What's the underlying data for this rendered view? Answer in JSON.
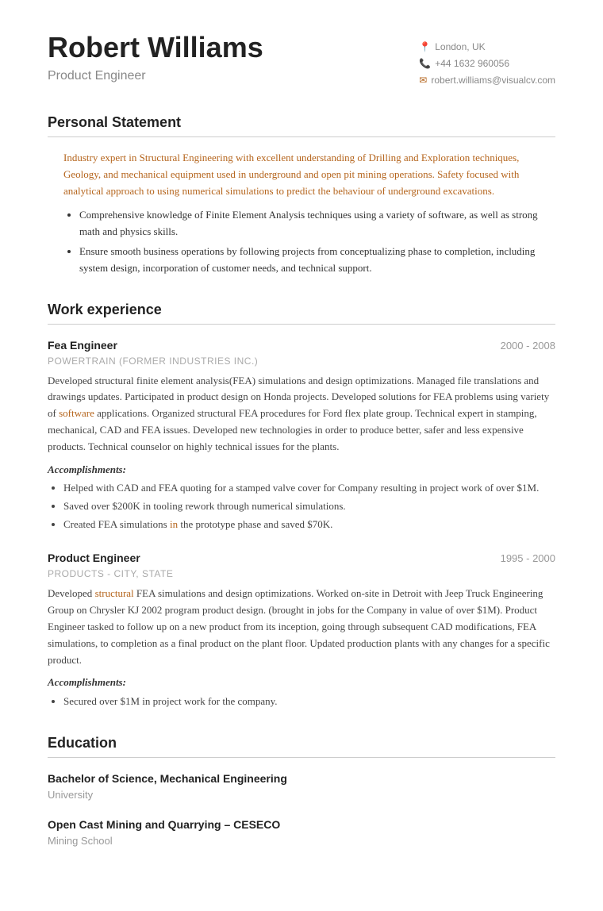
{
  "header": {
    "name": "Robert Williams",
    "title": "Product Engineer",
    "location": "London, UK",
    "phone": "+44 1632 960056",
    "email": "robert.williams@visualcv.com"
  },
  "sections": {
    "personal_statement": {
      "label": "Personal Statement",
      "intro": "Industry expert in Structural Engineering with excellent understanding of Drilling and Exploration techniques, Geology, and mechanical equipment used in underground and open pit mining operations. Safety focused with analytical approach to using numerical simulations to predict the behaviour of underground excavations.",
      "bullets": [
        "Comprehensive knowledge of Finite Element Analysis techniques using a variety of software, as well as strong math and physics skills.",
        "Ensure smooth business operations by following projects from conceptualizing phase to completion, including system design, incorporation of customer needs, and technical support."
      ]
    },
    "work_experience": {
      "label": "Work experience",
      "jobs": [
        {
          "title": "Fea Engineer",
          "dates": "2000 - 2008",
          "company": "POWERTRAIN (FORMER INDUSTRIES INC.)",
          "description": "Developed structural finite element analysis(FEA) simulations and design optimizations. Managed file translations and drawings updates. Participated in product design on Honda projects. Developed solutions for FEA problems using variety of software applications. Organized structural FEA procedures for Ford flex plate group. Technical expert in stamping, mechanical, CAD and FEA issues. Developed new technologies in order to produce better, safer and less expensive products. Technical counselor on highly technical issues for the plants.",
          "accomplishments_label": "Accomplishments:",
          "accomplishments": [
            "Helped with CAD and FEA quoting for a stamped valve cover for Company resulting in project work of over $1M.",
            "Saved over $200K in tooling rework through numerical simulations.",
            "Created FEA simulations in the prototype phase and saved $70K."
          ]
        },
        {
          "title": "Product Engineer",
          "dates": "1995 - 2000",
          "company": "PRODUCTS - CITY, STATE",
          "description": "Developed structural FEA simulations and design optimizations. Worked on-site in Detroit with Jeep Truck Engineering Group on Chrysler KJ 2002 program product design. (brought in jobs for the Company in value of over $1M). Product Engineer tasked to follow up on a new product from its inception, going through subsequent CAD modifications, FEA simulations, to completion as a final product on the plant floor. Updated production plants with any changes for a specific product.",
          "accomplishments_label": "Accomplishments:",
          "accomplishments": [
            "Secured over $1M in project work for the company."
          ]
        }
      ]
    },
    "education": {
      "label": "Education",
      "entries": [
        {
          "degree": "Bachelor of Science, Mechanical Engineering",
          "school": "University"
        },
        {
          "degree": "Open Cast Mining and Quarrying – CESECO",
          "school": "Mining School"
        }
      ]
    }
  },
  "icons": {
    "location": "📍",
    "phone": "📞",
    "email": "✉"
  }
}
